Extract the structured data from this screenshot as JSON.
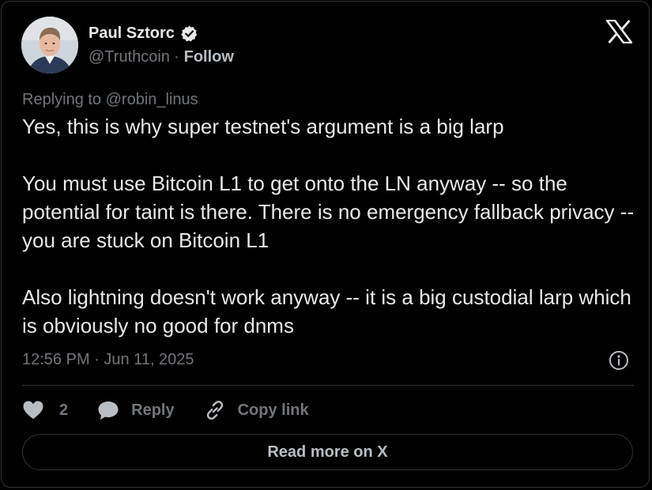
{
  "author": {
    "name": "Paul Sztorc",
    "handle": "@Truthcoin",
    "separator": "·",
    "follow_label": "Follow",
    "verified": true,
    "verified_icon": "verified-badge-icon"
  },
  "brand": {
    "logo_icon": "x-logo-icon"
  },
  "tweet": {
    "reply_to": "Replying to @robin_linus",
    "paragraphs": [
      "Yes, this is why super testnet's argument is a big larp",
      "You must use Bitcoin L1 to get onto the LN anyway -- so the potential for taint is there. There is no emergency fallback privacy -- you are stuck on Bitcoin L1",
      "Also lightning doesn't work anyway -- it is a big custodial larp which is obviously no good for dnms"
    ],
    "timestamp": "12:56 PM · Jun 11, 2025"
  },
  "actions": {
    "like_count": "2",
    "like_icon": "heart-icon",
    "reply_label": "Reply",
    "reply_icon": "speech-bubble-icon",
    "copy_label": "Copy link",
    "copy_icon": "link-icon",
    "info_icon": "info-icon"
  },
  "footer": {
    "read_more_label": "Read more on X"
  },
  "colors": {
    "background": "#000000",
    "border": "#2f3336",
    "primary_text": "#e7e9ea",
    "secondary_text": "#71767b",
    "verified_badge": "#e7e9ea"
  }
}
